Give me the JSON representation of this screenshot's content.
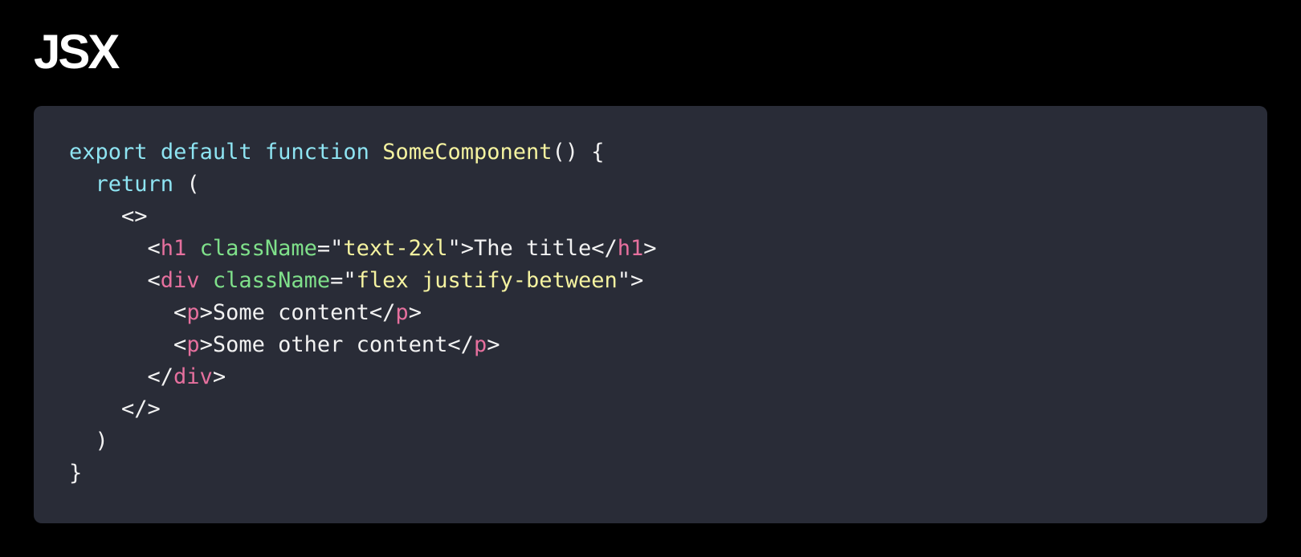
{
  "page": {
    "title": "JSX"
  },
  "colors": {
    "background": "#000000",
    "code_background": "#292c37",
    "plain": "#f2f2f2",
    "keyword": "#8ee4f2",
    "function_name": "#f5f3a0",
    "tag": "#e6709e",
    "attribute": "#7fe08a",
    "string": "#f5f3a0"
  },
  "code": {
    "language": "jsx",
    "lines": [
      [
        {
          "t": "export",
          "k": "keyword"
        },
        {
          "t": " ",
          "k": "plain"
        },
        {
          "t": "default",
          "k": "keyword"
        },
        {
          "t": " ",
          "k": "plain"
        },
        {
          "t": "function",
          "k": "keyword"
        },
        {
          "t": " ",
          "k": "plain"
        },
        {
          "t": "SomeComponent",
          "k": "function_name"
        },
        {
          "t": "() {",
          "k": "plain"
        }
      ],
      [
        {
          "t": "  ",
          "k": "plain"
        },
        {
          "t": "return",
          "k": "keyword"
        },
        {
          "t": " (",
          "k": "plain"
        }
      ],
      [
        {
          "t": "    <>",
          "k": "plain"
        }
      ],
      [
        {
          "t": "      <",
          "k": "plain"
        },
        {
          "t": "h1",
          "k": "tag"
        },
        {
          "t": " ",
          "k": "plain"
        },
        {
          "t": "className",
          "k": "attribute"
        },
        {
          "t": "=\"",
          "k": "plain"
        },
        {
          "t": "text-2xl",
          "k": "string"
        },
        {
          "t": "\">The title</",
          "k": "plain"
        },
        {
          "t": "h1",
          "k": "tag"
        },
        {
          "t": ">",
          "k": "plain"
        }
      ],
      [
        {
          "t": "      <",
          "k": "plain"
        },
        {
          "t": "div",
          "k": "tag"
        },
        {
          "t": " ",
          "k": "plain"
        },
        {
          "t": "className",
          "k": "attribute"
        },
        {
          "t": "=\"",
          "k": "plain"
        },
        {
          "t": "flex justify-between",
          "k": "string"
        },
        {
          "t": "\">",
          "k": "plain"
        }
      ],
      [
        {
          "t": "        <",
          "k": "plain"
        },
        {
          "t": "p",
          "k": "tag"
        },
        {
          "t": ">Some content</",
          "k": "plain"
        },
        {
          "t": "p",
          "k": "tag"
        },
        {
          "t": ">",
          "k": "plain"
        }
      ],
      [
        {
          "t": "        <",
          "k": "plain"
        },
        {
          "t": "p",
          "k": "tag"
        },
        {
          "t": ">Some other content</",
          "k": "plain"
        },
        {
          "t": "p",
          "k": "tag"
        },
        {
          "t": ">",
          "k": "plain"
        }
      ],
      [
        {
          "t": "      </",
          "k": "plain"
        },
        {
          "t": "div",
          "k": "tag"
        },
        {
          "t": ">",
          "k": "plain"
        }
      ],
      [
        {
          "t": "    </>",
          "k": "plain"
        }
      ],
      [
        {
          "t": "  )",
          "k": "plain"
        }
      ],
      [
        {
          "t": "}",
          "k": "plain"
        }
      ]
    ]
  }
}
